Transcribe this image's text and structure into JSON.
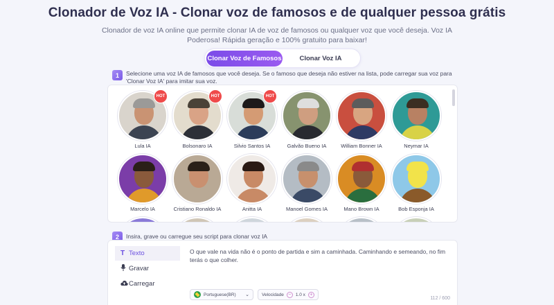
{
  "header": {
    "title": "Clonador de Voz IA - Clonar voz de famosos e de qualquer pessoa grátis",
    "subtitle": "Clonador de voz IA online que permite clonar IA de voz de famosos ou qualquer voz que você deseja. Voz IA Poderosa! Rápida geração e 100% gratuito para baixar!"
  },
  "mode_tabs": [
    {
      "label": "Clonar Voz de Famosos",
      "active": true
    },
    {
      "label": "Clonar Voz IA",
      "active": false
    }
  ],
  "step1": {
    "number": "1",
    "text": "Selecione uma voz IA de famosos que você deseja. Se o famoso que deseja não estiver na lista, pode carregar sua voz para 'Clonar Voz IA' para imitar sua voz."
  },
  "hot_label": "HOT",
  "voices": [
    {
      "name": "Lula IA",
      "hot": true,
      "bg": "#d9d4cc",
      "skin": "#c99373",
      "hair": "#9b9a98",
      "body": "#3c4452"
    },
    {
      "name": "Bolsonaro IA",
      "hot": true,
      "bg": "#e3dccd",
      "skin": "#d9a386",
      "hair": "#4a4238",
      "body": "#2d3038"
    },
    {
      "name": "Silvio Santos IA",
      "hot": true,
      "bg": "#d8ddd8",
      "skin": "#d49b74",
      "hair": "#1d1a1a",
      "body": "#2b3c5a"
    },
    {
      "name": "Galvão Bueno IA",
      "hot": false,
      "bg": "#87936f",
      "skin": "#cf9e80",
      "hair": "#dedede",
      "body": "#282a30"
    },
    {
      "name": "William Bonner IA",
      "hot": false,
      "bg": "#c94f3f",
      "skin": "#d8a581",
      "hair": "#5c5c5c",
      "body": "#2e3a64"
    },
    {
      "name": "Neymar IA",
      "hot": false,
      "bg": "#2e9a96",
      "skin": "#b88163",
      "hair": "#3b2e22",
      "body": "#d8d247"
    },
    {
      "name": "Marcelo IA",
      "hot": false,
      "bg": "#7b3da8",
      "skin": "#8a5a3c",
      "hair": "#2a1f18",
      "body": "#e09a2a"
    },
    {
      "name": "Cristiano Ronaldo IA",
      "hot": false,
      "bg": "#b9a995",
      "skin": "#c99070",
      "hair": "#2a2018",
      "body": "#b9a995"
    },
    {
      "name": "Anitta IA",
      "hot": false,
      "bg": "#efeae6",
      "skin": "#c88a66",
      "hair": "#2a1a14",
      "body": "#c88a66"
    },
    {
      "name": "Manoel Gomes IA",
      "hot": false,
      "bg": "#b4bcc4",
      "skin": "#c7906d",
      "hair": "#8a8a8a",
      "body": "#3a4a66"
    },
    {
      "name": "Mano Brown IA",
      "hot": false,
      "bg": "#d98c24",
      "skin": "#8a5a3a",
      "hair": "#b03030",
      "body": "#2a6e3e"
    },
    {
      "name": "Bob Esponja IA",
      "hot": false,
      "bg": "#8ec8e8",
      "skin": "#f2e34a",
      "hair": "#f2e34a",
      "body": "#8a5a2a"
    },
    {
      "name": "",
      "hot": false,
      "bg": "#8a7ad8",
      "skin": "#d8b090",
      "hair": "#3a2a2a",
      "body": "#3a2a2a"
    },
    {
      "name": "",
      "hot": false,
      "bg": "#d0c6b6",
      "skin": "#c99373",
      "hair": "#5a4030",
      "body": "#2a2a2a"
    },
    {
      "name": "",
      "hot": false,
      "bg": "#cfd6dc",
      "skin": "#c99373",
      "hair": "#3a3030",
      "body": "#2a2a2a"
    },
    {
      "name": "",
      "hot": false,
      "bg": "#dcd0c0",
      "skin": "#c99373",
      "hair": "#8a7a60",
      "body": "#2a2a2a"
    },
    {
      "name": "",
      "hot": false,
      "bg": "#b8c0c8",
      "skin": "#c99373",
      "hair": "#2a2a2a",
      "body": "#2a2a2a"
    },
    {
      "name": "",
      "hot": false,
      "bg": "#c8d0b8",
      "skin": "#c99373",
      "hair": "#4a3a2a",
      "body": "#2a2a2a"
    }
  ],
  "step2": {
    "number": "2",
    "text": "Insira, grave ou carregue seu script para clonar voz IA"
  },
  "script_menu": [
    {
      "label": "Texto",
      "icon": "text-icon",
      "active": true
    },
    {
      "label": "Gravar",
      "icon": "microphone-icon",
      "active": false
    },
    {
      "label": "Carregar",
      "icon": "cloud-upload-icon",
      "active": false
    }
  ],
  "script": {
    "text": "O que vale na vida não é o ponto de partida e sim a caminhada. Caminhando e semeando, no fim terás o que colher.",
    "language": "Portuguese(BR)",
    "speed_label": "Velocidade",
    "speed_value": "1.0 x",
    "counter": "112 / 600"
  }
}
